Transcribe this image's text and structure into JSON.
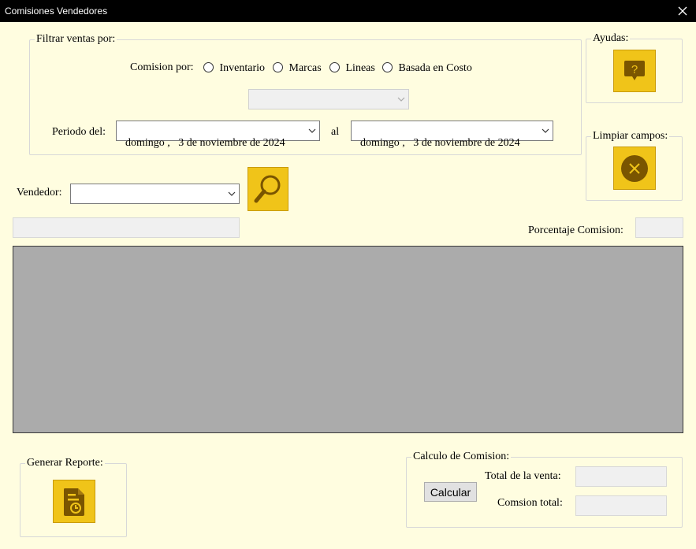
{
  "window": {
    "title": "Comisiones Vendedores"
  },
  "filter": {
    "legend": "Filtrar ventas por:",
    "comision_por_label": "Comision por:",
    "options": [
      "Inventario",
      "Marcas",
      "Lineas",
      "Basada en Costo"
    ],
    "period_label": "Periodo del:",
    "date_from": "domingo ,   3 de noviembre de 2024",
    "to_label": "al",
    "date_to": "domingo ,   3 de noviembre de 2024"
  },
  "help": {
    "legend": "Ayudas:",
    "icon": "help-bubble-icon"
  },
  "clear": {
    "legend": "Limpiar campos:",
    "icon": "close-circle-icon"
  },
  "vendedor": {
    "label": "Vendedor:",
    "value": ""
  },
  "porcentaje": {
    "label": "Porcentaje Comision:"
  },
  "reporte": {
    "legend": "Generar Reporte:",
    "icon": "report-document-icon"
  },
  "calculo": {
    "legend": "Calculo de Comision:",
    "calcular_label": "Calcular",
    "total_venta_label": "Total de la venta:",
    "comision_total_label": "Comsion total:"
  },
  "colors": {
    "background": "#fffde0",
    "accent": "#f0c419",
    "icon_dark": "#7a5500",
    "grid": "#ababab"
  }
}
